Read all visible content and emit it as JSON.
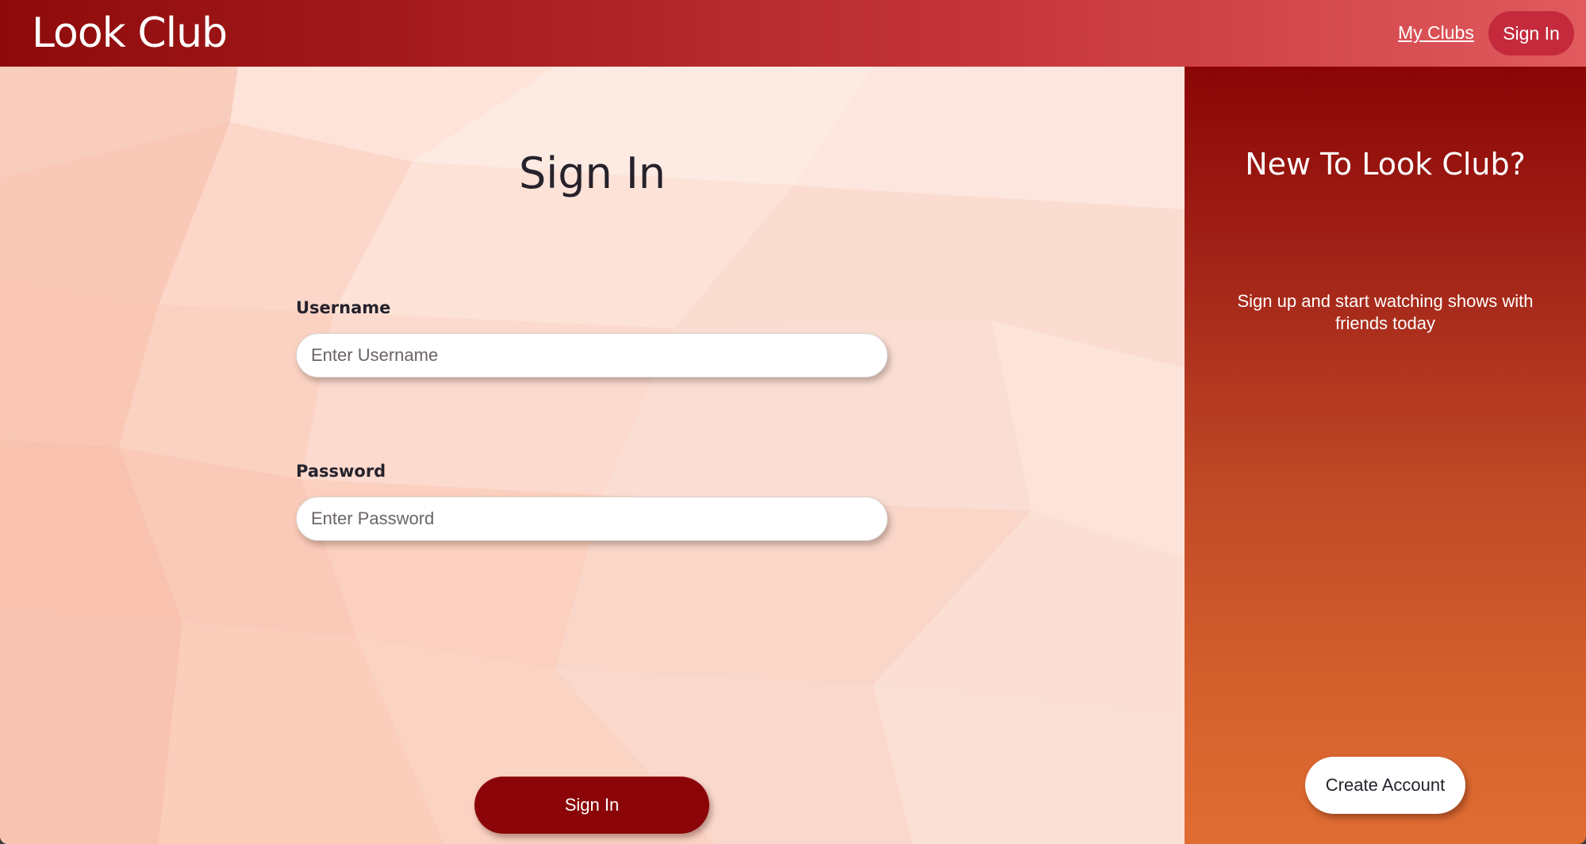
{
  "colors": {
    "header_start": "#8e0b0b",
    "header_end": "#e05a5e",
    "primary_button": "#8b0508",
    "right_panel_top": "#8b0506",
    "right_panel_bottom": "#e06d32",
    "left_panel_bg": "#fbd9cc",
    "text_dark": "#26222c"
  },
  "header": {
    "logo": "Look Club",
    "nav_my_clubs": "My Clubs",
    "nav_sign_in": "Sign In"
  },
  "signin_form": {
    "title": "Sign In",
    "username_label": "Username",
    "username_placeholder": "Enter Username",
    "username_value": "",
    "password_label": "Password",
    "password_placeholder": "Enter Password",
    "password_value": "",
    "submit_label": "Sign In"
  },
  "signup_panel": {
    "title": "New To Look Club?",
    "description": "Sign up and start watching shows with friends today",
    "create_label": "Create Account"
  }
}
